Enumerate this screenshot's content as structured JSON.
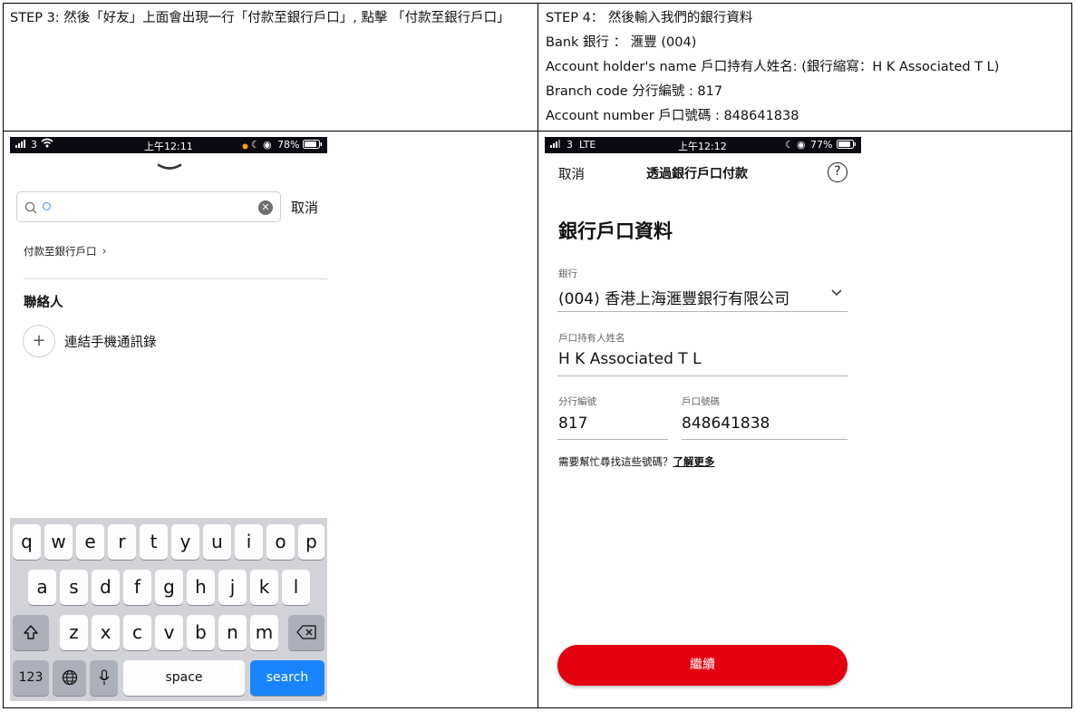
{
  "step3": {
    "text": "STEP 3:  然後「好友」上面會出現一行「付款至銀行戶口」, 點擊 「付款至銀行戶口」"
  },
  "step4": {
    "line1": "STEP 4：  然後輸入我們的銀行資料",
    "line2": "Bank    銀行 ：  滙豐  (004)",
    "line3": "Account holder's name  戶口持有人姓名: (銀行縮寫：H K Associated T L)",
    "line4": "Branch code  分行編號  : 817",
    "line5": "Account number  戶口號碼  : 848641838"
  },
  "phone1": {
    "status": {
      "signal": "3",
      "time": "上午12:11",
      "battery": "78%"
    },
    "search_query": "",
    "cancel_label": "取消",
    "pay_to_bank_label": "付款至銀行戶口",
    "contacts_heading": "聯絡人",
    "link_contacts_label": "連結手機通訊錄",
    "keyboard": {
      "row1": [
        "q",
        "w",
        "e",
        "r",
        "t",
        "y",
        "u",
        "i",
        "o",
        "p"
      ],
      "row2": [
        "a",
        "s",
        "d",
        "f",
        "g",
        "h",
        "j",
        "k",
        "l"
      ],
      "row3": [
        "z",
        "x",
        "c",
        "v",
        "b",
        "n",
        "m"
      ],
      "numbers_label": "123",
      "space_label": "space",
      "search_label": "search"
    }
  },
  "phone2": {
    "status": {
      "signal": "3",
      "network": "LTE",
      "time": "上午12:12",
      "battery": "77%"
    },
    "nav_cancel": "取消",
    "nav_title": "透過銀行戶口付款",
    "section_title": "銀行戶口資料",
    "bank_label": "銀行",
    "bank_value": "(004) 香港上海滙豐銀行有限公司",
    "holder_label": "戶口持有人姓名",
    "holder_value": "H K Associated T L",
    "branch_label": "分行編號",
    "branch_value": "817",
    "account_label": "戶口號碼",
    "account_value": "848641838",
    "help_text": "需要幫忙尋找這些號碼？",
    "learn_more": "了解更多",
    "continue_label": "繼續"
  },
  "colors": {
    "accent_red": "#e3000f",
    "ios_blue": "#1a84ff"
  }
}
